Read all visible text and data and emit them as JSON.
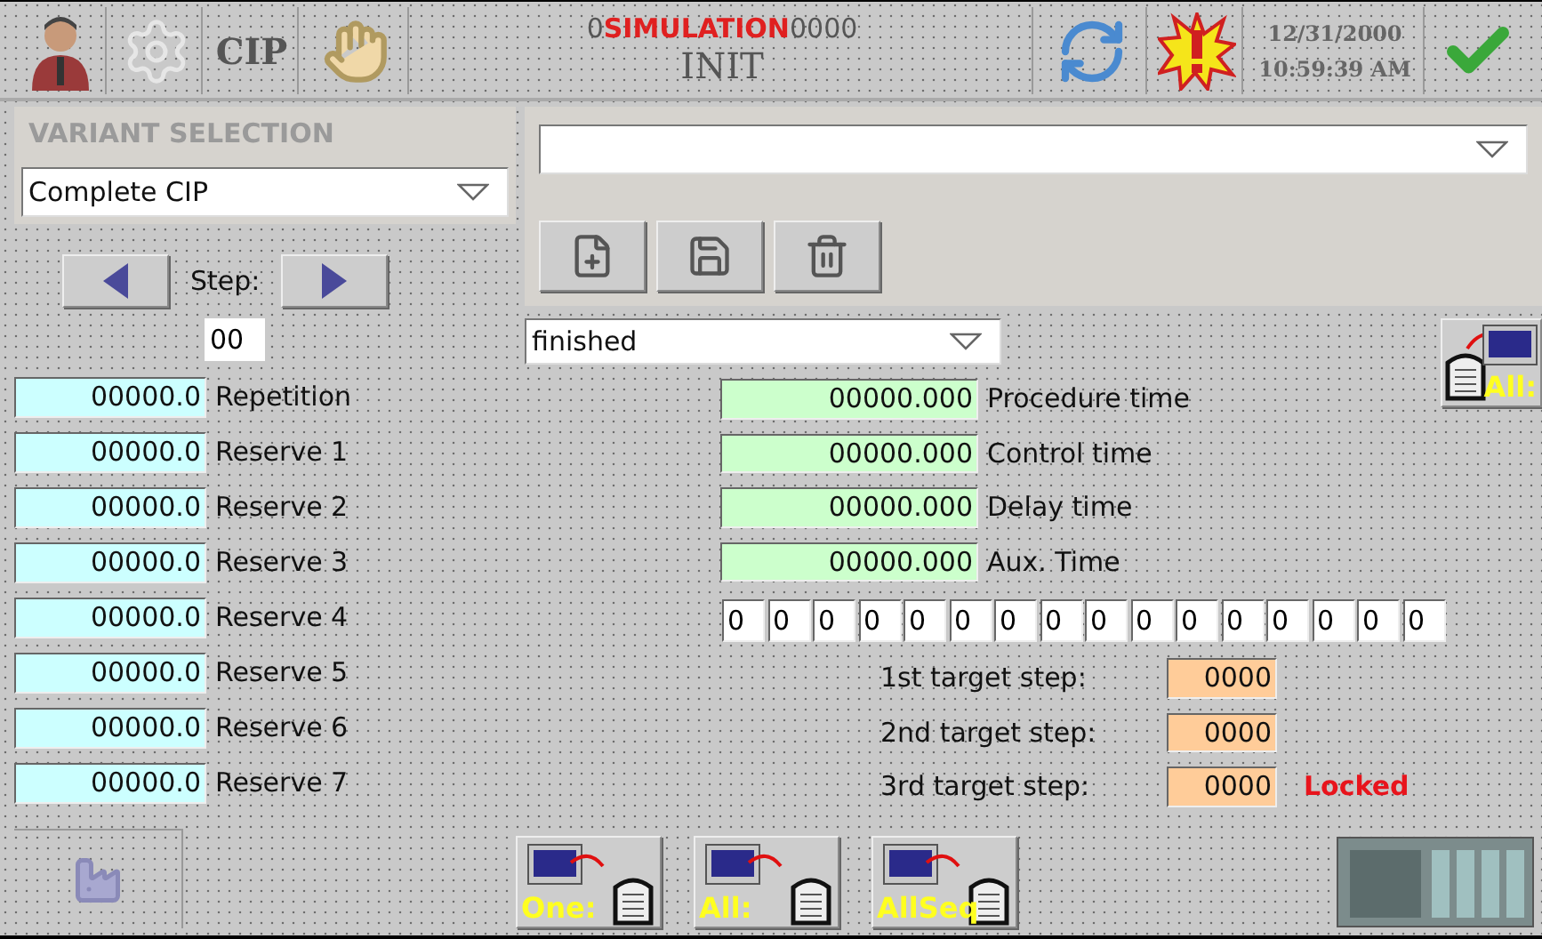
{
  "toolbar": {
    "cip_label": "CIP",
    "counter_prefix": "0",
    "simulation": "SIMULATION",
    "counter_suffix": "0000",
    "status": "INIT",
    "date": "12/31/2000",
    "time": "10:59:39 AM"
  },
  "variant_selection": {
    "title": "VARIANT SELECTION",
    "dropdown": "Complete CIP",
    "step_label": "Step:",
    "step": "00"
  },
  "parameters": [
    {
      "value": "00000.0",
      "label": "Repetition"
    },
    {
      "value": "00000.0",
      "label": "Reserve 1"
    },
    {
      "value": "00000.0",
      "label": "Reserve 2"
    },
    {
      "value": "00000.0",
      "label": "Reserve 3"
    },
    {
      "value": "00000.0",
      "label": "Reserve 4"
    },
    {
      "value": "00000.0",
      "label": "Reserve 5"
    },
    {
      "value": "00000.0",
      "label": "Reserve 6"
    },
    {
      "value": "00000.0",
      "label": "Reserve 7"
    }
  ],
  "state_dropdown": "finished",
  "upload_all_label": "All:",
  "times": [
    {
      "value": "00000.000",
      "label": "Procedure time"
    },
    {
      "value": "00000.000",
      "label": "Control time"
    },
    {
      "value": "00000.000",
      "label": "Delay time"
    },
    {
      "value": "00000.000",
      "label": "Aux. Time"
    }
  ],
  "bits": [
    "0",
    "0",
    "0",
    "0",
    "0",
    "0",
    "0",
    "0",
    "0",
    "0",
    "0",
    "0",
    "0",
    "0",
    "0",
    "0"
  ],
  "target_steps": [
    {
      "label": "1st target step:",
      "value": "0000"
    },
    {
      "label": "2nd target step:",
      "value": "0000"
    },
    {
      "label": "3rd target step:",
      "value": "0000"
    }
  ],
  "lock_status": "Locked",
  "transfer_buttons": [
    "One:",
    "All:",
    "AllSeq"
  ]
}
